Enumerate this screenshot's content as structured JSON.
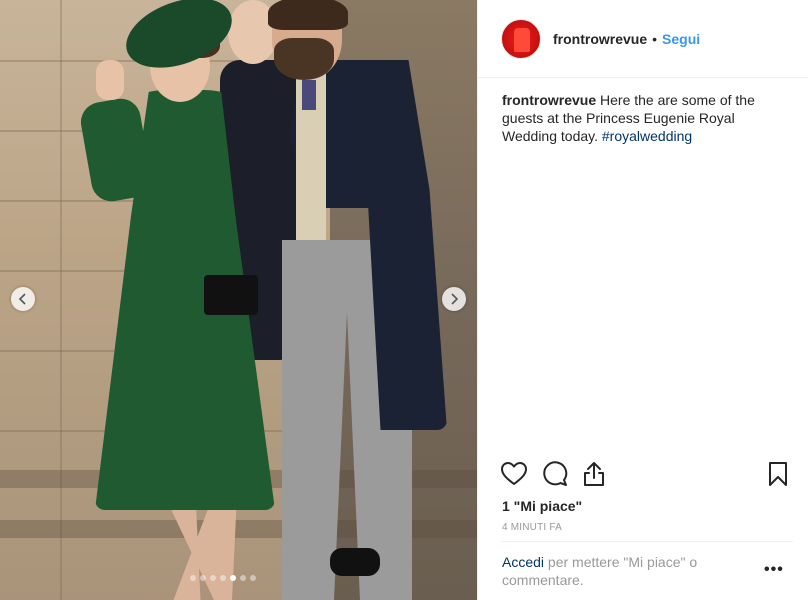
{
  "post": {
    "username": "frontrowrevue",
    "separator": "•",
    "follow_label": "Segui",
    "caption_user": "frontrowrevue",
    "caption_text": " Here the are some of the guests at the Princess Eugenie Royal Wedding today. ",
    "hashtag": "#royalwedding",
    "likes": "1 \"Mi piace\"",
    "timestamp": "4 minuti fa",
    "login_link": "Accedi",
    "login_rest": " per mettere \"Mi piace\" o commentare.",
    "more": "•••"
  },
  "carousel": {
    "slide_count": 7,
    "active_index": 4
  },
  "colors": {
    "link_blue": "#3897f0",
    "text_dark": "#262626",
    "text_muted": "#999999",
    "hashtag": "#003569",
    "avatar_red": "#cc1111"
  },
  "icons": [
    "heart-icon",
    "comment-icon",
    "share-icon",
    "bookmark-icon",
    "chevron-left-icon",
    "chevron-right-icon"
  ]
}
